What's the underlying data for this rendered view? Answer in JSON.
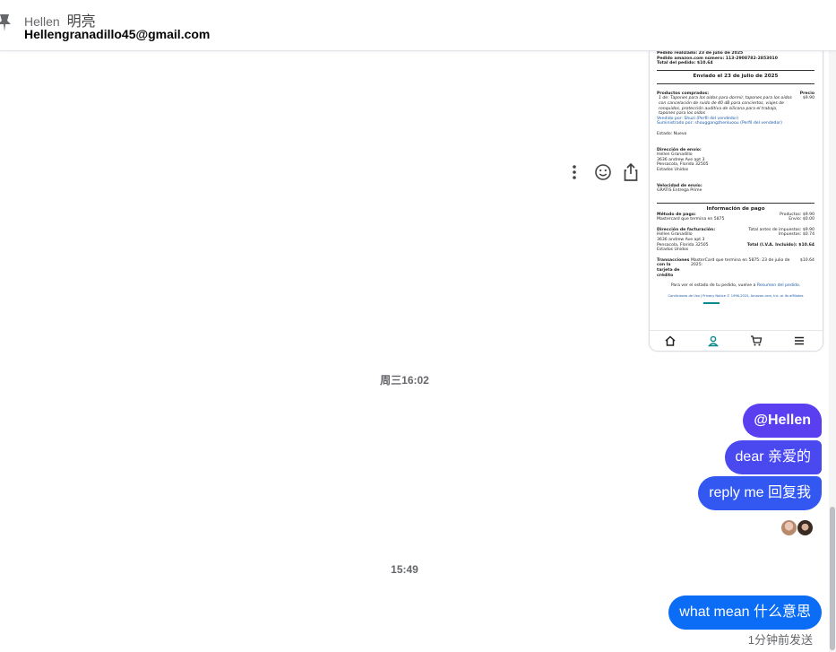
{
  "header": {
    "name": "Hellen",
    "name_cn": "明亮",
    "email": "Hellengranadillo45@gmail.com"
  },
  "attachment": {
    "lines": {
      "order_date": "Pedido realizado: 23 de julio de 2025",
      "order_number": "Pedido amazon.com número: 113-2908782-2853010",
      "order_total": "Total del pedido: $10.64",
      "shipped": "Enviado el 23 de julio de 2025",
      "products_label": "Productos comprados:",
      "price_label": "Precio",
      "product_desc": "1 de: Tapones para los oídos para dormir, tapones para los oídos con cancelación de ruido de 40 dB para conciertos, viajes de ronquidos, protección auditiva de silicona para el trabajo, tapones para los oídos",
      "product_price": "$9.90",
      "sold_by": "Vendido por: Shuzi (Perfil del vendedor)",
      "supplied_by": "Suministrado por: shouggangzhenluoou (Perfil del vendedor)",
      "condition": "Estado: Nuevo",
      "ship_to_label": "Dirección de envío:",
      "ship_name": "Hellen Granadillo",
      "ship_street": "3636 andrew Ave apt 3",
      "ship_city": "Pensacola, Florida 32505",
      "ship_country": "Estados Unidos",
      "speed_label": "Velocidad de envío:",
      "speed_value": "GRATIS Entrega Prime",
      "payment_info": "Información de pago",
      "payment_method_label": "Método de pago:",
      "payment_method": "Mastercard  que termina en 5875",
      "items_label": "Productos:",
      "items_value": "$9.90",
      "shipping_label": "Envío:",
      "shipping_value": "$0.00",
      "billing_label": "Dirección de facturación:",
      "pretax_label": "Total antes de impuestos:",
      "pretax_value": "$9.90",
      "tax_label": "Impuestos:",
      "tax_value": "$0.74",
      "bill_name": "Hellen Granadillo",
      "bill_street": "3636 andrew Ave apt 3",
      "bill_city": "Pensacola, Florida 32505",
      "bill_country": "Estados Unidos",
      "total_label": "Total (I.V.A. Incluido):",
      "total_value": "$10.64",
      "transactions_label": "Transacciones con la tarjeta de crédito",
      "transactions_value": "MasterCard que termina en 5875: 23 de julio de 2025:",
      "transactions_amount": "$10.64",
      "status_note": "Para ver el estado de tu pedido, vuelve a",
      "status_link": "Resumen del pedido.",
      "footer": "Condiciones de Uso | Privacy Notice © 1996-2025, Amazon.com, Inc. or its affiliates"
    }
  },
  "timestamps": {
    "first": "周三16:02",
    "second": "15:49"
  },
  "messages": [
    {
      "text": "@Hellen"
    },
    {
      "text": "dear  亲爱的"
    },
    {
      "text": "reply me  回复我"
    },
    {
      "text": "what mean  什么意思"
    }
  ],
  "sent_status": "1分钟前发送",
  "icons": {
    "pin": "pin-icon",
    "more": "more-options-icon",
    "react": "emoji-react-icon",
    "share": "share-icon",
    "home": "home-icon",
    "account": "account-icon",
    "cart": "cart-icon",
    "menu": "menu-icon"
  },
  "colors": {
    "bubble_1": "#5a3ff0",
    "bubble_2": "#4a48ef",
    "bubble_3": "#3358f1",
    "bubble_4": "#0b6cf5",
    "muted_text": "#65676b"
  }
}
